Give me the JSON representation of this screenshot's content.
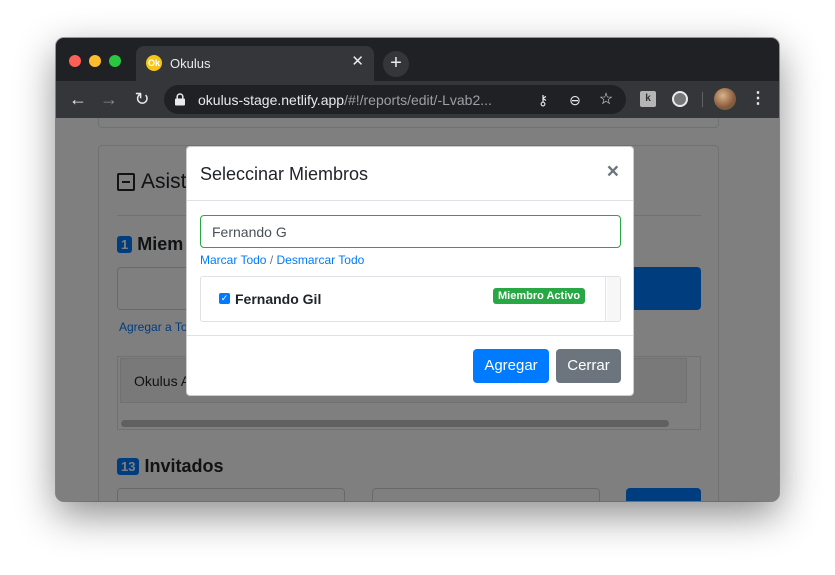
{
  "browser": {
    "tab_title": "Okulus",
    "tab_favicon": "Ok",
    "url_host": "okulus-stage.netlify.app",
    "url_path": "/#!/reports/edit/-Lvab2...",
    "extension_label": "k"
  },
  "page": {
    "title": "Asist",
    "members_count": "1",
    "members_label": "Miem",
    "add_all_link": "Agregar a To",
    "table_cell": "Okulus A",
    "guests_count": "13",
    "guests_label": "Invitados"
  },
  "modal": {
    "title": "Seleccinar Miembros",
    "close_symbol": "×",
    "search_value": "Fernando G",
    "select_all": "Marcar Todo",
    "separator": " / ",
    "deselect_all": "Desmarcar Todo",
    "results": [
      {
        "name": "Fernando Gil",
        "badge": "Miembro Activo",
        "checked": true
      }
    ],
    "add_button": "Agregar",
    "close_button": "Cerrar"
  },
  "colors": {
    "primary": "#007bff",
    "secondary": "#6c757d",
    "success": "#28a745"
  }
}
